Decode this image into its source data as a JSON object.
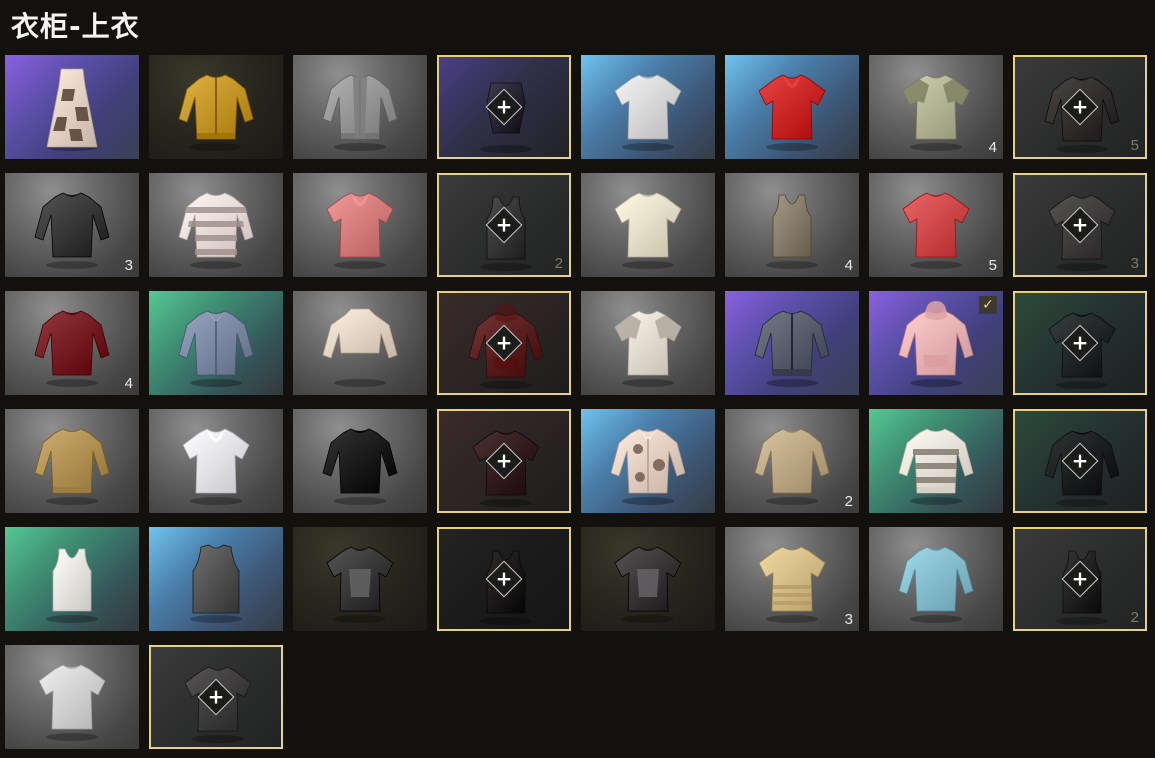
{
  "title": "衣柜-上衣",
  "wardrobe_items": [
    {
      "bg": "purple",
      "garment": "patterned-dress",
      "color": "#e8d6c8",
      "count": "",
      "empty": false
    },
    {
      "bg": "dark",
      "garment": "bomber-jacket",
      "color": "#c89a2c",
      "count": "",
      "empty": false
    },
    {
      "bg": "gray",
      "garment": "hoodie-jacket",
      "color": "#9a9a9a",
      "count": "",
      "empty": false
    },
    {
      "bg": "empty",
      "tint": "purple",
      "garment": "corset",
      "color": "#2a2630",
      "count": "",
      "empty": true
    },
    {
      "bg": "blue",
      "garment": "tshirt",
      "color": "#dcdcdc",
      "count": "",
      "empty": false
    },
    {
      "bg": "blue",
      "garment": "polo",
      "color": "#cf2b2b",
      "count": "",
      "empty": false
    },
    {
      "bg": "gray",
      "garment": "raglan-tee",
      "color": "#b7b89a",
      "count": "4",
      "empty": false
    },
    {
      "bg": "empty",
      "tint": "gray",
      "garment": "long-tee",
      "color": "#3a3434",
      "count": "5",
      "empty": true
    },
    {
      "bg": "gray",
      "garment": "long-tee",
      "color": "#3c3c3c",
      "count": "3",
      "empty": false
    },
    {
      "bg": "gray",
      "garment": "striped-long-tee",
      "color": "#f0e0dc",
      "count": "",
      "empty": false
    },
    {
      "bg": "gray",
      "garment": "polo",
      "color": "#d98181",
      "count": "",
      "empty": false
    },
    {
      "bg": "empty",
      "tint": "gray",
      "garment": "tank-top",
      "color": "#3e3e3e",
      "count": "2",
      "empty": true
    },
    {
      "bg": "gray",
      "garment": "tshirt",
      "color": "#eae3cc",
      "count": "",
      "empty": false
    },
    {
      "bg": "gray",
      "garment": "tank-top",
      "color": "#8b806e",
      "count": "4",
      "empty": false
    },
    {
      "bg": "gray",
      "garment": "tshirt",
      "color": "#d24d4d",
      "count": "5",
      "empty": false
    },
    {
      "bg": "empty",
      "tint": "gray",
      "garment": "tshirt",
      "color": "#4a4746",
      "count": "3",
      "empty": true
    },
    {
      "bg": "gray",
      "garment": "long-tee",
      "color": "#7a1f27",
      "count": "4",
      "empty": false
    },
    {
      "bg": "green",
      "garment": "button-shirt",
      "color": "#7f8ea6",
      "count": "",
      "empty": false
    },
    {
      "bg": "gray",
      "garment": "crop-long",
      "color": "#ead9c9",
      "count": "",
      "empty": false
    },
    {
      "bg": "empty",
      "tint": "red",
      "garment": "hoodie",
      "color": "#6e2220",
      "count": "",
      "empty": true
    },
    {
      "bg": "gray",
      "garment": "raglan-tee",
      "color": "#e6e0d4",
      "count": "",
      "empty": false
    },
    {
      "bg": "purple",
      "garment": "bomber-jacket",
      "color": "#5d6270",
      "count": "",
      "empty": false
    },
    {
      "bg": "purple",
      "garment": "hoodie",
      "color": "#f2b7b9",
      "count": "",
      "empty": false,
      "selected": true
    },
    {
      "bg": "empty",
      "tint": "green",
      "garment": "tshirt",
      "color": "#26282a",
      "count": "",
      "empty": true
    },
    {
      "bg": "gray",
      "garment": "sweater",
      "color": "#b59658",
      "count": "",
      "empty": false
    },
    {
      "bg": "gray",
      "garment": "polo",
      "color": "#e9e9ee",
      "count": "",
      "empty": false
    },
    {
      "bg": "gray",
      "garment": "long-tee",
      "color": "#1b1b1b",
      "count": "",
      "empty": false
    },
    {
      "bg": "empty",
      "tint": "red",
      "garment": "tshirt",
      "color": "#3a1c1d",
      "count": "",
      "empty": true
    },
    {
      "bg": "blue",
      "garment": "floral-shirt",
      "color": "#e9d4c6",
      "count": "",
      "empty": false
    },
    {
      "bg": "gray",
      "garment": "long-tee",
      "color": "#c1ac89",
      "count": "2",
      "empty": false
    },
    {
      "bg": "green",
      "garment": "patterned-sweater",
      "color": "#efe8dc",
      "count": "",
      "empty": false
    },
    {
      "bg": "empty",
      "tint": "green",
      "garment": "long-tee",
      "color": "#18191a",
      "count": "",
      "empty": true
    },
    {
      "bg": "green",
      "garment": "tank-top",
      "color": "#ecebe4",
      "count": "",
      "empty": false
    },
    {
      "bg": "blue",
      "garment": "vest",
      "color": "#565656",
      "count": "",
      "empty": false
    },
    {
      "bg": "dark",
      "garment": "print-tee",
      "color": "#3c3c3c",
      "count": "",
      "empty": false
    },
    {
      "bg": "empty",
      "tint": "dark",
      "garment": "tank-top",
      "color": "#1c1616",
      "count": "",
      "empty": true
    },
    {
      "bg": "dark",
      "garment": "print-tee",
      "color": "#3e3a3c",
      "count": "",
      "empty": false
    },
    {
      "bg": "gray",
      "garment": "striped-tee",
      "color": "#d9c18a",
      "count": "3",
      "empty": false
    },
    {
      "bg": "gray",
      "garment": "long-tee",
      "color": "#8ac1d0",
      "count": "",
      "empty": false
    },
    {
      "bg": "empty",
      "tint": "gray",
      "garment": "tank-top",
      "color": "#1f1f1f",
      "count": "2",
      "empty": true
    },
    {
      "bg": "gray",
      "garment": "tshirt",
      "color": "#d6d6d6",
      "count": "",
      "empty": false
    },
    {
      "bg": "empty",
      "tint": "gray",
      "garment": "tshirt",
      "color": "#4a4848",
      "count": "",
      "empty": true
    }
  ],
  "add_icon_text": "+",
  "check_icon_text": "✓"
}
